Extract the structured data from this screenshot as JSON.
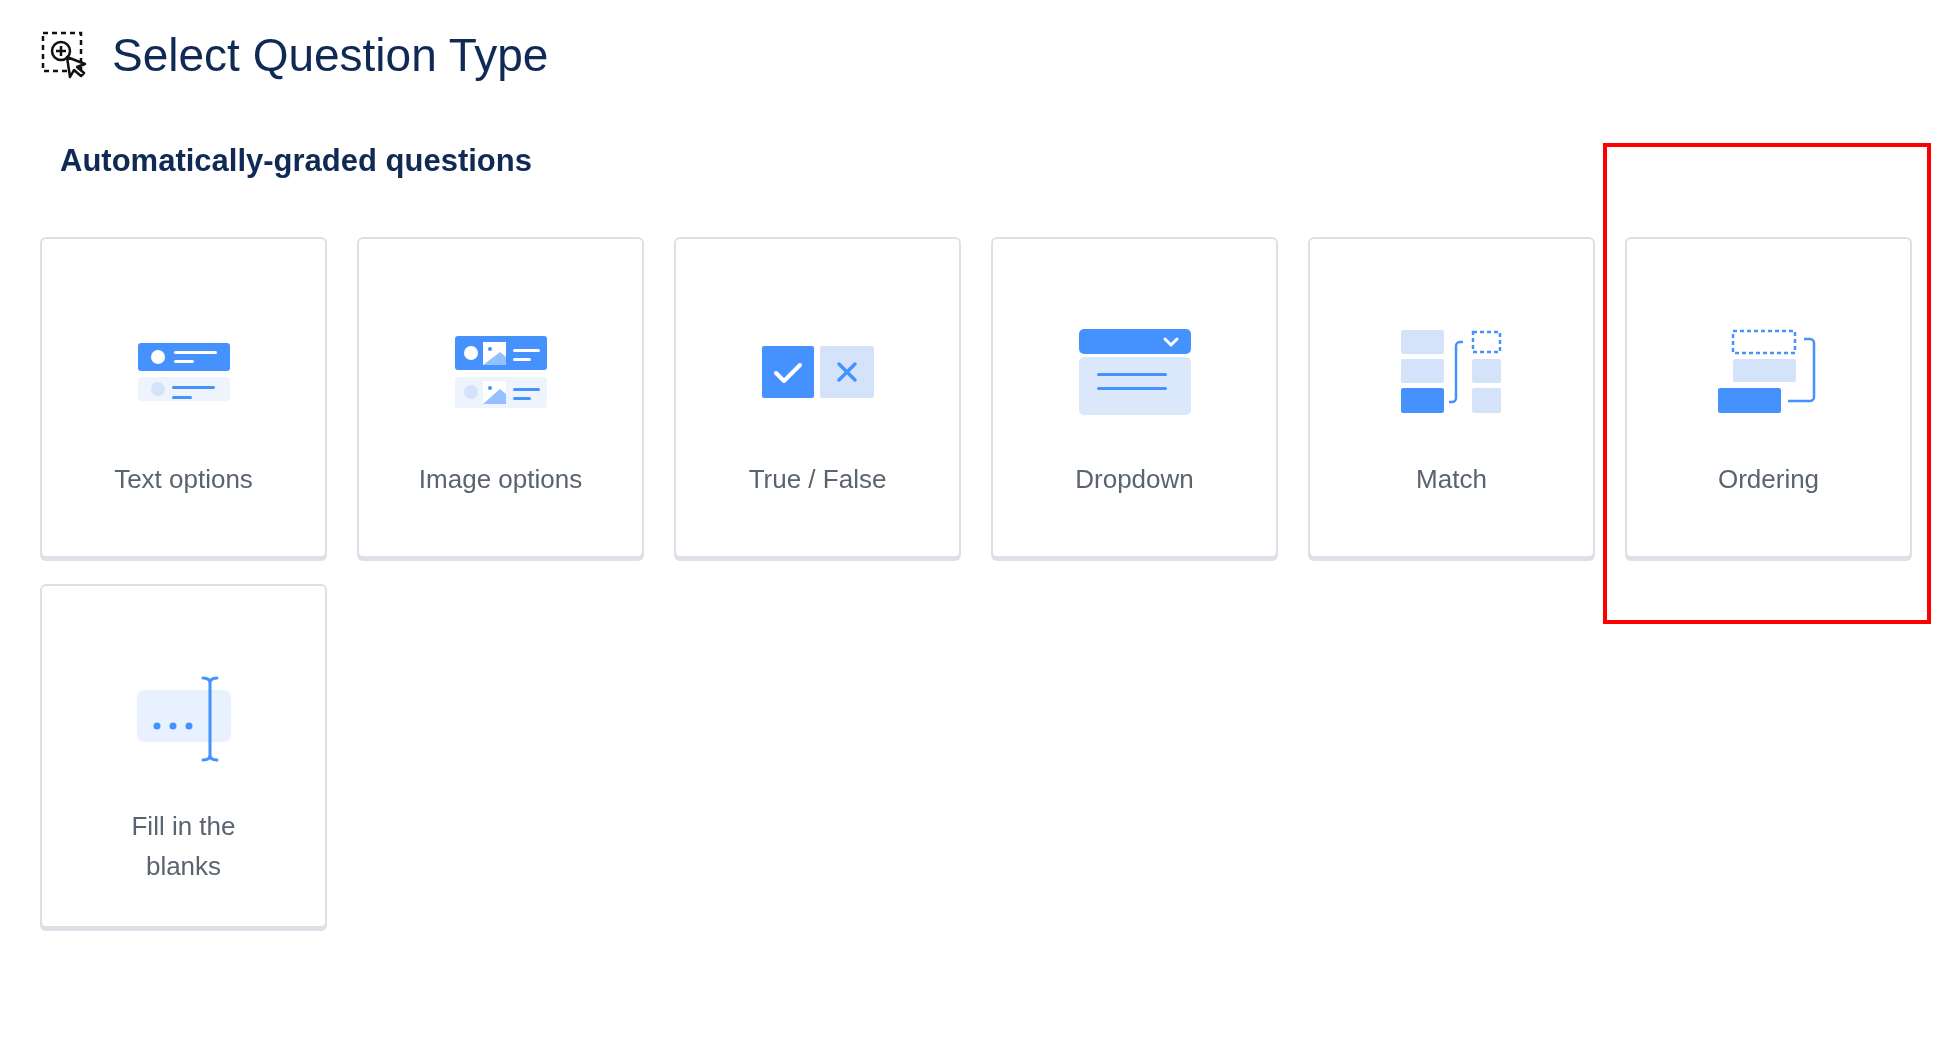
{
  "header": {
    "title": "Select Question Type"
  },
  "section": {
    "heading": "Automatically-graded questions"
  },
  "cards": [
    {
      "kind": "text-options",
      "label": "Text options",
      "highlighted": false
    },
    {
      "kind": "image-options",
      "label": "Image options",
      "highlighted": false
    },
    {
      "kind": "true-false",
      "label": "True / False",
      "highlighted": false
    },
    {
      "kind": "dropdown",
      "label": "Dropdown",
      "highlighted": false
    },
    {
      "kind": "match",
      "label": "Match",
      "highlighted": false
    },
    {
      "kind": "ordering",
      "label": "Ordering",
      "highlighted": true
    },
    {
      "kind": "fill-blanks",
      "label": "Fill in the blanks",
      "highlighted": false
    }
  ]
}
